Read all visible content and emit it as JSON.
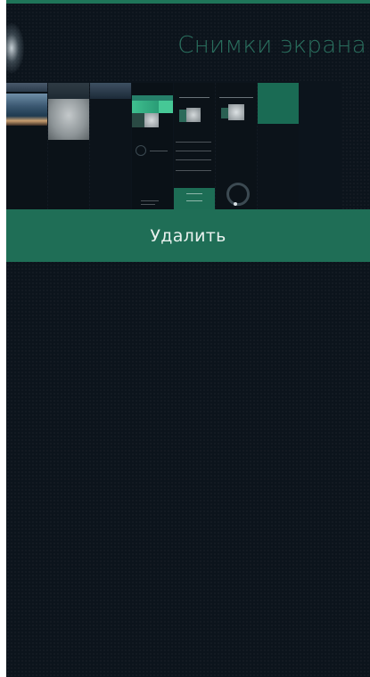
{
  "header": {
    "title": "Снимки экрана"
  },
  "context_menu": {
    "delete_label": "Удалить"
  },
  "colors": {
    "background": "#0c141c",
    "accent": "#1f6e56",
    "title": "#2a6f5e"
  },
  "grid": {
    "thumbnails": [
      "screenshot-1",
      "screenshot-2",
      "screenshot-3",
      "screenshot-4",
      "screenshot-5",
      "screenshot-6",
      "screenshot-7",
      "screenshot-8",
      "screenshot-9"
    ]
  }
}
